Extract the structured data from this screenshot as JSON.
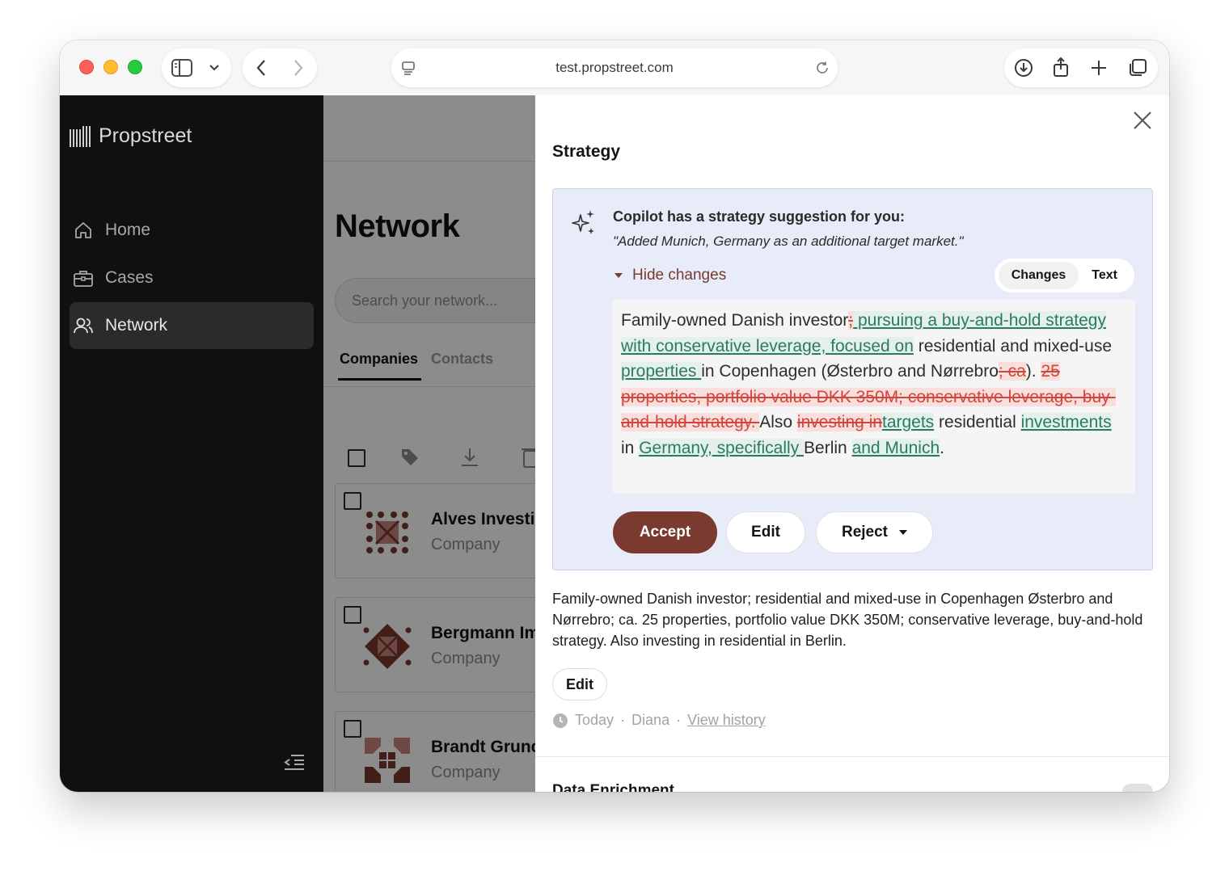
{
  "browser": {
    "url": "test.propstreet.com"
  },
  "sidebar": {
    "brand": "Propstreet",
    "items": [
      {
        "label": "Home",
        "icon": "home-icon"
      },
      {
        "label": "Cases",
        "icon": "briefcase-icon"
      },
      {
        "label": "Network",
        "icon": "users-icon",
        "active": true
      }
    ]
  },
  "main": {
    "title": "Network",
    "search_placeholder": "Search your network...",
    "tabs": [
      "Companies",
      "Contacts"
    ],
    "rows": [
      {
        "name": "Alves Investi",
        "type": "Company"
      },
      {
        "name": "Bergmann Im",
        "type": "Company"
      },
      {
        "name": "Brandt Grunc",
        "type": "Company"
      }
    ]
  },
  "drawer": {
    "title": "Strategy",
    "suggestion": {
      "heading": "Copilot has a strategy suggestion for you:",
      "quote": "\"Added Munich, Germany as an additional target market.\"",
      "toggle_label": "Hide changes",
      "view_options": [
        "Changes",
        "Text"
      ],
      "diff": [
        {
          "t": "plain",
          "v": "Family-owned Danish investor"
        },
        {
          "t": "del",
          "v": ";"
        },
        {
          "t": "ins",
          "v": " pursuing a buy-and-hold strategy with conservative leverage, focused on"
        },
        {
          "t": "plain",
          "v": " residential and mixed-use "
        },
        {
          "t": "ins",
          "v": "properties "
        },
        {
          "t": "plain",
          "v": "in Copenhagen (Østerbro and Nørrebro"
        },
        {
          "t": "del",
          "v": "; ca"
        },
        {
          "t": "plain",
          "v": "). "
        },
        {
          "t": "del",
          "v": "25 properties, portfolio value DKK 350M; conservative leverage, buy-and-hold strategy. "
        },
        {
          "t": "plain",
          "v": "Also "
        },
        {
          "t": "del",
          "v": "investing in"
        },
        {
          "t": "ins",
          "v": "targets"
        },
        {
          "t": "plain",
          "v": " residential "
        },
        {
          "t": "ins",
          "v": "investments "
        },
        {
          "t": "plain",
          "v": "in "
        },
        {
          "t": "ins",
          "v": "Germany, specifically "
        },
        {
          "t": "plain",
          "v": "Berlin "
        },
        {
          "t": "ins",
          "v": "and Munich"
        },
        {
          "t": "plain",
          "v": "."
        }
      ],
      "accept_label": "Accept",
      "edit_label": "Edit",
      "reject_label": "Reject"
    },
    "current_text": "Family-owned Danish investor; residential and mixed-use in Copenhagen Østerbro and Nørrebro; ca. 25 properties, portfolio value DKK 350M; conservative leverage, buy-and-hold strategy. Also investing in residential in Berlin.",
    "edit_label": "Edit",
    "meta": {
      "date": "Today",
      "author": "Diana",
      "history_link": "View history"
    },
    "next_section_title": "Data Enrichment"
  },
  "colors": {
    "accent": "#7b3a2f",
    "insert": "#2c7a60",
    "delete": "#d2453a",
    "suggestion_bg": "#e8ecf8"
  }
}
